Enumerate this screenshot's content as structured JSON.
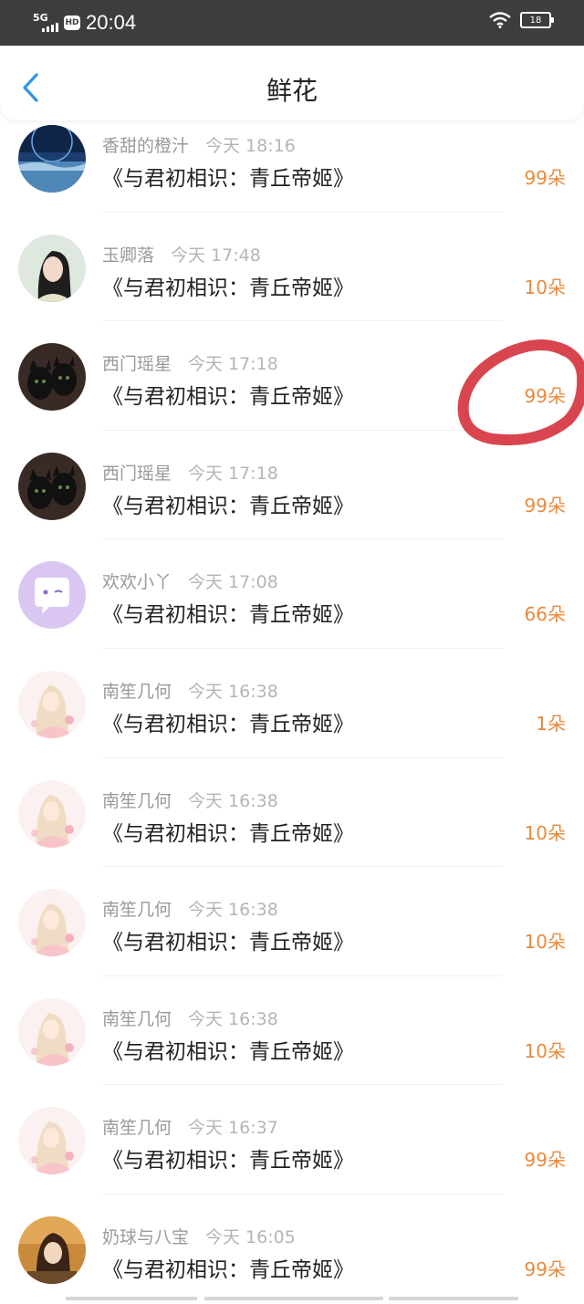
{
  "status_bar": {
    "network": "5G",
    "hd": "HD",
    "time": "20:04",
    "battery": "18"
  },
  "header": {
    "title": "鲜花"
  },
  "colors": {
    "accent_blue": "#2f96e8",
    "count_orange": "#e88a3d",
    "annotation_red": "#d9454e"
  },
  "items": [
    {
      "name": "香甜的橙汁",
      "time": "今天 18:16",
      "book": "《与君初相识：青丘帝姬》",
      "count": "99朵",
      "avatar": "night-sky"
    },
    {
      "name": "玉卿落",
      "time": "今天 17:48",
      "book": "《与君初相识：青丘帝姬》",
      "count": "10朵",
      "avatar": "girl-portrait"
    },
    {
      "name": "西门瑶星",
      "time": "今天 17:18",
      "book": "《与君初相识：青丘帝姬》",
      "count": "99朵",
      "avatar": "black-cats"
    },
    {
      "name": "西门瑶星",
      "time": "今天 17:18",
      "book": "《与君初相识：青丘帝姬》",
      "count": "99朵",
      "avatar": "black-cats"
    },
    {
      "name": "欢欢小丫",
      "time": "今天 17:08",
      "book": "《与君初相识：青丘帝姬》",
      "count": "66朵",
      "avatar": "purple-chat"
    },
    {
      "name": "南笙几何",
      "time": "今天 16:38",
      "book": "《与君初相识：青丘帝姬》",
      "count": "1朵",
      "avatar": "pink-anime"
    },
    {
      "name": "南笙几何",
      "time": "今天 16:38",
      "book": "《与君初相识：青丘帝姬》",
      "count": "10朵",
      "avatar": "pink-anime"
    },
    {
      "name": "南笙几何",
      "time": "今天 16:38",
      "book": "《与君初相识：青丘帝姬》",
      "count": "10朵",
      "avatar": "pink-anime"
    },
    {
      "name": "南笙几何",
      "time": "今天 16:38",
      "book": "《与君初相识：青丘帝姬》",
      "count": "10朵",
      "avatar": "pink-anime"
    },
    {
      "name": "南笙几何",
      "time": "今天 16:37",
      "book": "《与君初相识：青丘帝姬》",
      "count": "99朵",
      "avatar": "pink-anime"
    },
    {
      "name": "奶球与八宝",
      "time": "今天 16:05",
      "book": "《与君初相识：青丘帝姬》",
      "count": "99朵",
      "avatar": "girl-photo"
    }
  ]
}
